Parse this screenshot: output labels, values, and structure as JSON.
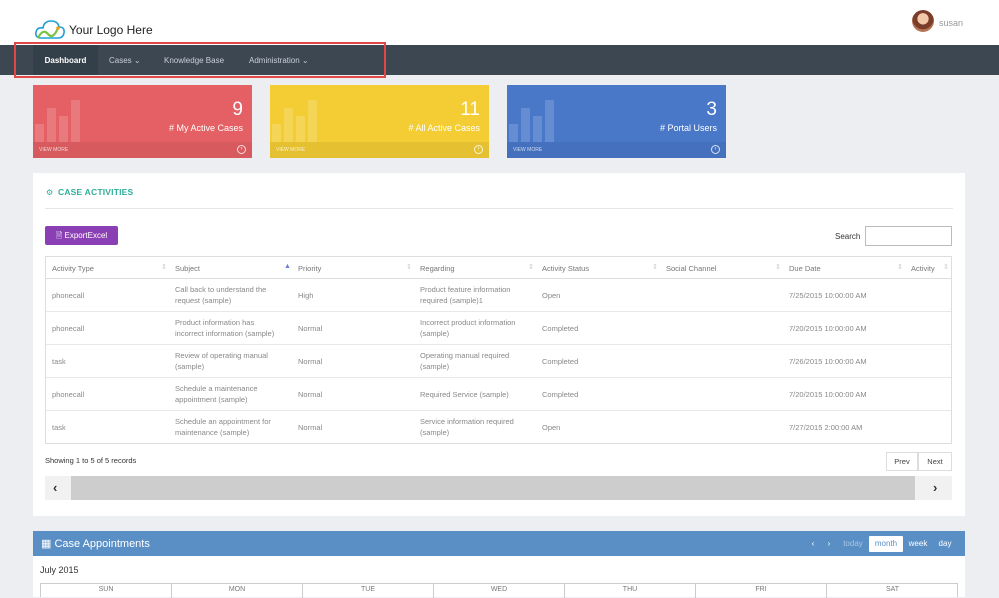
{
  "header": {
    "logo_text": "Your Logo Here",
    "username": "susan"
  },
  "nav": {
    "items": [
      {
        "label": "Dashboard"
      },
      {
        "label": "Cases ⌄"
      },
      {
        "label": "Knowledge Base"
      },
      {
        "label": "Administration ⌄"
      }
    ]
  },
  "tiles": [
    {
      "value": "9",
      "label": "# My Active Cases",
      "footer": "VIEW MORE",
      "color": "#e46064"
    },
    {
      "value": "11",
      "label": "# All Active Cases",
      "footer": "VIEW MORE",
      "color": "#f4cd35"
    },
    {
      "value": "3",
      "label": "# Portal Users",
      "footer": "VIEW MORE",
      "color": "#4978c9"
    }
  ],
  "activities": {
    "title": "CASE ACTIVITIES",
    "export_label": "ExportExcel",
    "search_label": "Search",
    "columns": [
      "Activity Type",
      "Subject",
      "Priority",
      "Regarding",
      "Activity Status",
      "Social Channel",
      "Due Date",
      "Activity"
    ],
    "rows": [
      {
        "type": "phonecall",
        "subject": [
          "Call back to understand the",
          "request (sample)"
        ],
        "priority": "High",
        "regarding": [
          "Product feature information",
          "required (sample)1"
        ],
        "status": "Open",
        "channel": "",
        "due": "7/25/2015 10:00:00 AM"
      },
      {
        "type": "phonecall",
        "subject": [
          "Product information has",
          "incorrect information (sample)"
        ],
        "priority": "Normal",
        "regarding": [
          "Incorrect product information",
          "(sample)"
        ],
        "status": "Completed",
        "channel": "",
        "due": "7/20/2015 10:00:00 AM"
      },
      {
        "type": "task",
        "subject": [
          "Review of operating manual",
          "(sample)"
        ],
        "priority": "Normal",
        "regarding": [
          "Operating manual required",
          "(sample)"
        ],
        "status": "Completed",
        "channel": "",
        "due": "7/26/2015 10:00:00 AM"
      },
      {
        "type": "phonecall",
        "subject": [
          "Schedule a maintenance",
          "appointment (sample)"
        ],
        "priority": "Normal",
        "regarding": [
          "Required Service (sample)",
          ""
        ],
        "status": "Completed",
        "channel": "",
        "due": "7/20/2015 10:00:00 AM"
      },
      {
        "type": "task",
        "subject": [
          "Schedule an appointment for",
          "maintenance (sample)"
        ],
        "priority": "Normal",
        "regarding": [
          "Service information required",
          "(sample)"
        ],
        "status": "Open",
        "channel": "",
        "due": "7/27/2015 2:00:00 AM"
      }
    ],
    "showing": "Showing 1 to 5 of 5 records",
    "prev": "Prev",
    "next": "Next"
  },
  "calendar": {
    "title": "Case Appointments",
    "today": "today",
    "views": [
      "month",
      "week",
      "day"
    ],
    "month_label": "July 2015",
    "days": [
      "SUN",
      "MON",
      "TUE",
      "WED",
      "THU",
      "FRI",
      "SAT"
    ]
  }
}
